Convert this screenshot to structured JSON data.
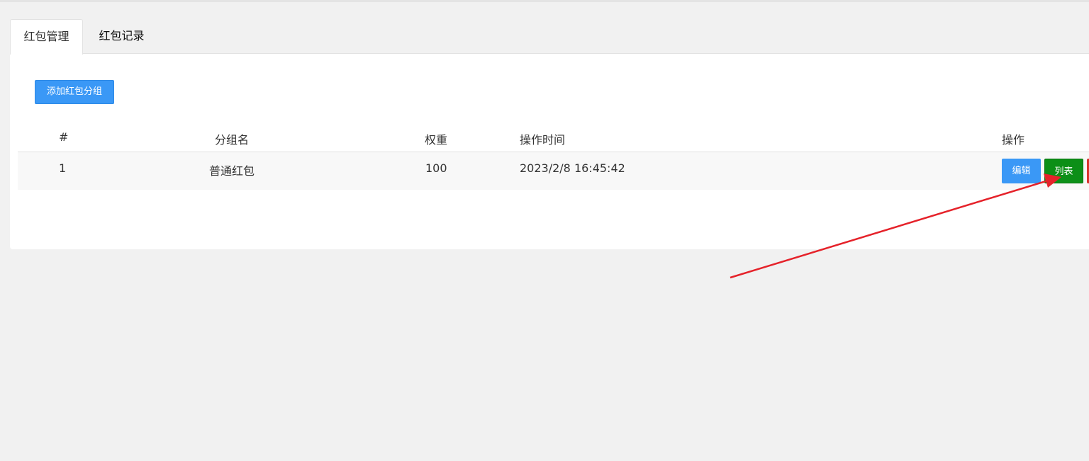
{
  "tabs": [
    {
      "label": "红包管理",
      "active": true
    },
    {
      "label": "红包记录",
      "active": false
    }
  ],
  "toolbar": {
    "add_label": "添加红包分组"
  },
  "table": {
    "headers": {
      "idx": "#",
      "name": "分组名",
      "weight": "权重",
      "time": "操作时间",
      "ops": "操作"
    },
    "rows": [
      {
        "idx": "1",
        "name": "普通红包",
        "weight": "100",
        "time": "2023/2/8 16:45:42"
      }
    ],
    "actions": {
      "edit": "编辑",
      "list": "列表"
    }
  },
  "colors": {
    "primary": "#3a98f6",
    "success": "#0c8f17",
    "danger": "#d9352f",
    "annotation": "#e5222a"
  }
}
